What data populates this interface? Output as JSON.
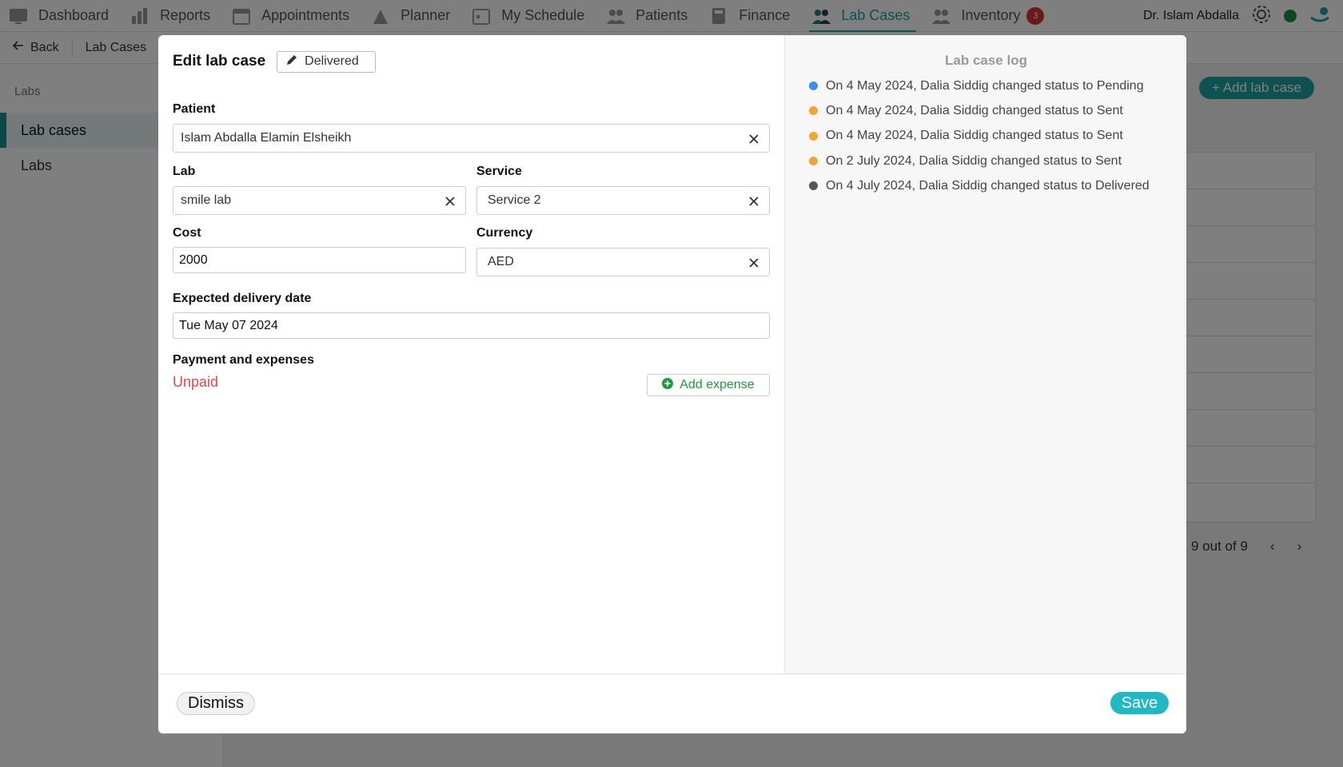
{
  "topnav": {
    "items": [
      {
        "label": "Dashboard",
        "icon": "dashboard-icon"
      },
      {
        "label": "Reports",
        "icon": "reports-icon"
      },
      {
        "label": "Appointments",
        "icon": "calendar-icon"
      },
      {
        "label": "Planner",
        "icon": "planner-icon"
      },
      {
        "label": "My Schedule",
        "icon": "schedule-icon"
      },
      {
        "label": "Patients",
        "icon": "patients-icon"
      },
      {
        "label": "Finance",
        "icon": "finance-icon"
      },
      {
        "label": "Lab Cases",
        "icon": "lab-cases-icon"
      },
      {
        "label": "Inventory",
        "icon": "inventory-icon"
      }
    ],
    "inventory_badge": "3",
    "user_name": "Dr. Islam Abdalla"
  },
  "subbar": {
    "back_label": "Back",
    "crumb": "Lab Cases"
  },
  "sidebar": {
    "heading": "Labs",
    "items": [
      {
        "label": "Lab cases"
      },
      {
        "label": "Labs"
      }
    ]
  },
  "background": {
    "add_button": "+ Add lab case",
    "pager": "9 out of 9"
  },
  "modal": {
    "title": "Edit lab case",
    "status": "Delivered",
    "patient": {
      "label": "Patient",
      "value": "Islam Abdalla Elamin Elsheikh"
    },
    "lab": {
      "label": "Lab",
      "value": "smile lab"
    },
    "service": {
      "label": "Service",
      "value": "Service 2"
    },
    "cost": {
      "label": "Cost",
      "value": "2000"
    },
    "currency": {
      "label": "Currency",
      "value": "AED"
    },
    "delivery": {
      "label": "Expected delivery date",
      "value": "Tue May 07 2024"
    },
    "payment": {
      "label": "Payment and expenses",
      "status": "Unpaid",
      "add_expense": "Add expense"
    },
    "log": {
      "title": "Lab case log",
      "entries": [
        {
          "text": "On 4 May 2024, Dalia Siddig changed status to Pending",
          "color": "#3b8ef0"
        },
        {
          "text": "On 4 May 2024, Dalia Siddig changed status to Sent",
          "color": "#f3a533"
        },
        {
          "text": "On 4 May 2024, Dalia Siddig changed status to Sent",
          "color": "#f3a533"
        },
        {
          "text": "On 2 July 2024, Dalia Siddig changed status to Sent",
          "color": "#f3a533"
        },
        {
          "text": "On 4 July 2024, Dalia Siddig changed status to Delivered",
          "color": "#555555"
        }
      ]
    },
    "dismiss": "Dismiss",
    "save": "Save"
  },
  "colors": {
    "accent": "#1aa3a3",
    "save": "#1fb8c4",
    "unpaid": "#e0474c",
    "add_expense": "#1e9a3a"
  }
}
